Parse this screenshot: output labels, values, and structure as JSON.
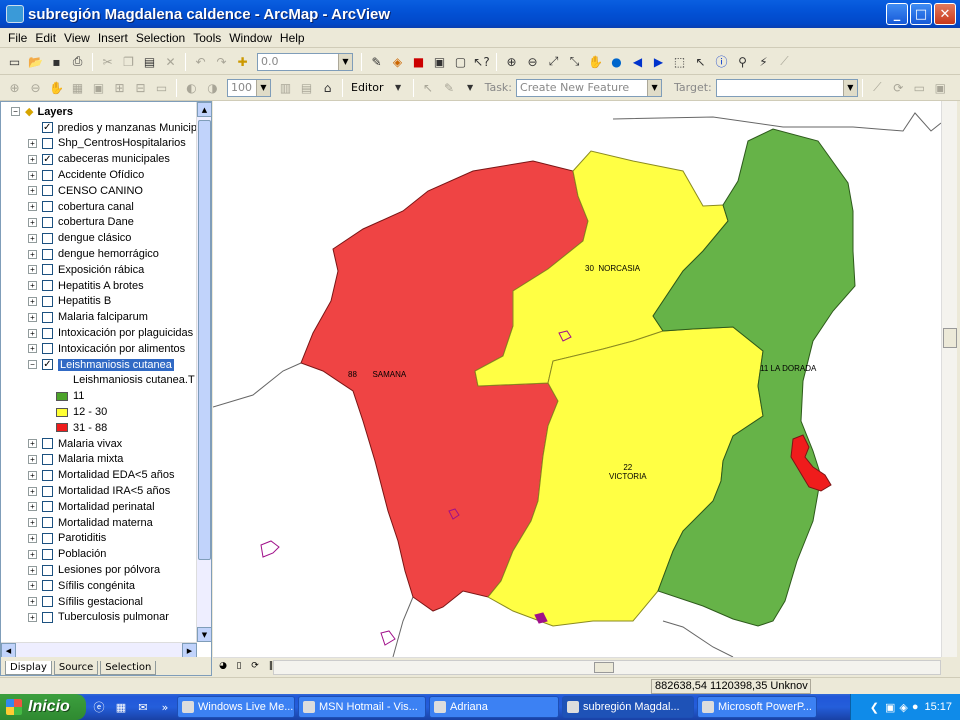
{
  "window": {
    "title": "subregión Magdalena caldence - ArcMap - ArcView",
    "buttons": {
      "minimize": "_",
      "maximize": "□",
      "close": "✕"
    }
  },
  "menu": [
    "File",
    "Edit",
    "View",
    "Insert",
    "Selection",
    "Tools",
    "Window",
    "Help"
  ],
  "toolbar1": {
    "scale_value": "0.0",
    "icons": [
      "new-icon",
      "open-icon",
      "save-icon",
      "print-icon",
      "cut-icon",
      "copy-icon",
      "paste-icon",
      "delete-icon",
      "undo-icon",
      "redo-icon",
      "add-data-icon",
      "editor-toolbar-icon",
      "arctoolbox-icon",
      "python-icon",
      "layout-icon",
      "whats-this-icon",
      "zoom-in-icon",
      "zoom-out-icon",
      "fixed-zoom-in-icon",
      "fixed-zoom-out-icon",
      "pan-icon",
      "full-extent-icon",
      "back-icon",
      "forward-icon",
      "select-features-icon",
      "select-elements-icon",
      "identify-icon",
      "find-icon",
      "hyperlink-icon",
      "measure-icon"
    ]
  },
  "toolbar2": {
    "zoom_value": "100",
    "editor_label": "Editor",
    "task_label": "Task:",
    "task_value": "Create New Feature",
    "target_label": "Target:",
    "target_value": ""
  },
  "toc": {
    "tabs": [
      "Display",
      "Source",
      "Selection"
    ],
    "root": "Layers",
    "layers": [
      {
        "label": "predios y manzanas Municip",
        "checked": true,
        "tree": ""
      },
      {
        "label": "Shp_CentrosHospitalarios",
        "checked": false,
        "tree": "+"
      },
      {
        "label": "cabeceras municipales",
        "checked": true,
        "tree": "+"
      },
      {
        "label": "Accidente Ofídico",
        "checked": false,
        "tree": "+"
      },
      {
        "label": "CENSO CANINO",
        "checked": false,
        "tree": "+"
      },
      {
        "label": "cobertura canal",
        "checked": false,
        "tree": "+"
      },
      {
        "label": "cobertura Dane",
        "checked": false,
        "tree": "+"
      },
      {
        "label": "dengue clásico",
        "checked": false,
        "tree": "+"
      },
      {
        "label": "dengue hemorrágico",
        "checked": false,
        "tree": "+"
      },
      {
        "label": "Exposición rábica",
        "checked": false,
        "tree": "+"
      },
      {
        "label": "Hepatitis A brotes",
        "checked": false,
        "tree": "+"
      },
      {
        "label": "Hepatitis B",
        "checked": false,
        "tree": "+"
      },
      {
        "label": "Malaria falciparum",
        "checked": false,
        "tree": "+"
      },
      {
        "label": "Intoxicación por plaguicidas",
        "checked": false,
        "tree": "+"
      },
      {
        "label": "Intoxicación por alimentos",
        "checked": false,
        "tree": "+"
      },
      {
        "label": "Leishmaniosis cutanea",
        "checked": true,
        "tree": "-",
        "selected": true
      }
    ],
    "legend_field": "Leishmaniosis cutanea.T",
    "legend": [
      {
        "label": "11",
        "color": "#4ca32a"
      },
      {
        "label": "12 - 30",
        "color": "#ffff33"
      },
      {
        "label": "31 - 88",
        "color": "#ef1c1c"
      }
    ],
    "layers_after": [
      {
        "label": "Malaria vivax",
        "checked": false
      },
      {
        "label": "Malaria mixta",
        "checked": false
      },
      {
        "label": "Mortalidad EDA<5 años",
        "checked": false
      },
      {
        "label": "Mortalidad IRA<5 años",
        "checked": false
      },
      {
        "label": "Mortalidad perinatal",
        "checked": false
      },
      {
        "label": "Mortalidad materna",
        "checked": false
      },
      {
        "label": "Parotiditis",
        "checked": false
      },
      {
        "label": "Población",
        "checked": false
      },
      {
        "label": "Lesiones por pólvora",
        "checked": false
      },
      {
        "label": "Sífilis congénita",
        "checked": false
      },
      {
        "label": "Sífilis gestacional",
        "checked": false
      },
      {
        "label": "Tuberculosis pulmonar",
        "checked": false
      }
    ]
  },
  "map": {
    "regions": [
      {
        "name": "SAMANA",
        "value": "88",
        "color": "#ef4444"
      },
      {
        "name": "NORCASIA",
        "value": "30",
        "color": "#ffff44"
      },
      {
        "name": "VICTORIA",
        "value": "22",
        "color": "#ffff44"
      },
      {
        "name": "LA DORADA",
        "value": "11",
        "color": "#66b348"
      }
    ]
  },
  "status": {
    "coords": "882638,54  1120398,35 Unknov"
  },
  "taskbar": {
    "start": "Inicio",
    "tasks": [
      {
        "label": "Windows Live Me...",
        "active": false
      },
      {
        "label": "MSN Hotmail - Vis...",
        "active": false
      },
      {
        "label": "Adriana",
        "active": false
      },
      {
        "label": "subregión Magdal...",
        "active": true
      },
      {
        "label": "Microsoft PowerP...",
        "active": false
      }
    ],
    "clock": "15:17"
  }
}
